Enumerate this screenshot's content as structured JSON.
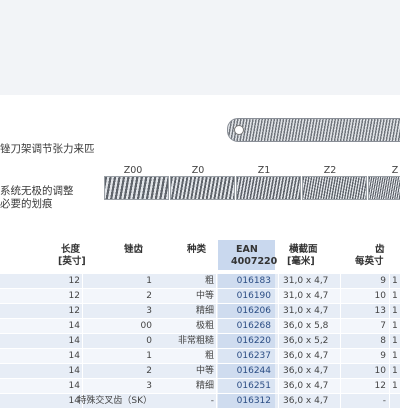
{
  "description": {
    "line1": "锉刀架调节张力来匹",
    "line2a": "系统无极的调整",
    "line2b": "必要的划痕"
  },
  "grades": [
    {
      "label": "Z00",
      "color": "#7b8088"
    },
    {
      "label": "Z0",
      "color": "#7b8088"
    },
    {
      "label": "Z1",
      "color": "#7b8088"
    },
    {
      "label": "Z2",
      "color": "#7b8088"
    },
    {
      "label": "Z",
      "color": "#7b8088"
    }
  ],
  "table": {
    "headers": {
      "length_1": "长度",
      "length_2": "[英寸]",
      "cut": "锉齿",
      "type": "种类",
      "ean_1": "EAN",
      "ean_2": "4007220",
      "section_1": "横截面",
      "section_2": "[毫米]",
      "teeth_1": "齿",
      "teeth_2": "每英寸"
    },
    "rows": [
      {
        "length": "12",
        "cut": "1",
        "type": "粗",
        "ean": "016183",
        "section": "31,0 x 4,7",
        "teeth": "9",
        "extra": "1"
      },
      {
        "length": "12",
        "cut": "2",
        "type": "中等",
        "ean": "016190",
        "section": "31,0 x 4,7",
        "teeth": "10",
        "extra": "1"
      },
      {
        "length": "12",
        "cut": "3",
        "type": "精细",
        "ean": "016206",
        "section": "31,0 x 4,7",
        "teeth": "13",
        "extra": "1"
      },
      {
        "length": "14",
        "cut": "00",
        "type": "极粗",
        "ean": "016268",
        "section": "36,0 x 5,8",
        "teeth": "7",
        "extra": "1"
      },
      {
        "length": "14",
        "cut": "0",
        "type": "非常粗糙",
        "ean": "016220",
        "section": "36,0 x 5,2",
        "teeth": "8",
        "extra": "1"
      },
      {
        "length": "14",
        "cut": "1",
        "type": "粗",
        "ean": "016237",
        "section": "36,0 x 4,7",
        "teeth": "9",
        "extra": "1"
      },
      {
        "length": "14",
        "cut": "2",
        "type": "中等",
        "ean": "016244",
        "section": "36,0 x 4,7",
        "teeth": "10",
        "extra": "1"
      },
      {
        "length": "14",
        "cut": "3",
        "type": "精细",
        "ean": "016251",
        "section": "36,0 x 4,7",
        "teeth": "12",
        "extra": "1"
      },
      {
        "length": "14",
        "cut": "特殊交叉齿（SK）",
        "type": "-",
        "ean": "016312",
        "section": "36,0 x 4,7",
        "teeth": "-",
        "extra": ""
      }
    ]
  }
}
